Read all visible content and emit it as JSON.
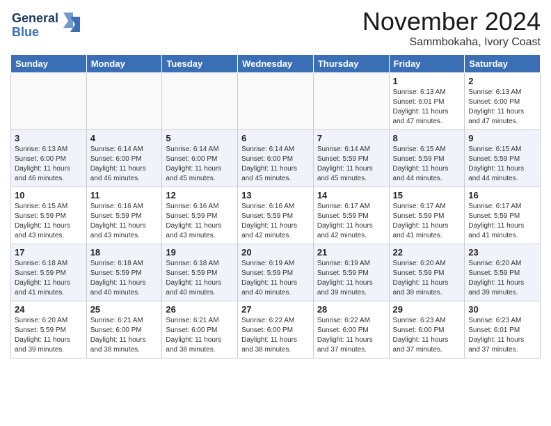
{
  "header": {
    "logo_general": "General",
    "logo_blue": "Blue",
    "month": "November 2024",
    "location": "Sammbokaha, Ivory Coast"
  },
  "weekdays": [
    "Sunday",
    "Monday",
    "Tuesday",
    "Wednesday",
    "Thursday",
    "Friday",
    "Saturday"
  ],
  "weeks": [
    [
      {
        "day": "",
        "info": ""
      },
      {
        "day": "",
        "info": ""
      },
      {
        "day": "",
        "info": ""
      },
      {
        "day": "",
        "info": ""
      },
      {
        "day": "",
        "info": ""
      },
      {
        "day": "1",
        "info": "Sunrise: 6:13 AM\nSunset: 6:01 PM\nDaylight: 11 hours and 47 minutes."
      },
      {
        "day": "2",
        "info": "Sunrise: 6:13 AM\nSunset: 6:00 PM\nDaylight: 11 hours and 47 minutes."
      }
    ],
    [
      {
        "day": "3",
        "info": "Sunrise: 6:13 AM\nSunset: 6:00 PM\nDaylight: 11 hours and 46 minutes."
      },
      {
        "day": "4",
        "info": "Sunrise: 6:14 AM\nSunset: 6:00 PM\nDaylight: 11 hours and 46 minutes."
      },
      {
        "day": "5",
        "info": "Sunrise: 6:14 AM\nSunset: 6:00 PM\nDaylight: 11 hours and 45 minutes."
      },
      {
        "day": "6",
        "info": "Sunrise: 6:14 AM\nSunset: 6:00 PM\nDaylight: 11 hours and 45 minutes."
      },
      {
        "day": "7",
        "info": "Sunrise: 6:14 AM\nSunset: 5:59 PM\nDaylight: 11 hours and 45 minutes."
      },
      {
        "day": "8",
        "info": "Sunrise: 6:15 AM\nSunset: 5:59 PM\nDaylight: 11 hours and 44 minutes."
      },
      {
        "day": "9",
        "info": "Sunrise: 6:15 AM\nSunset: 5:59 PM\nDaylight: 11 hours and 44 minutes."
      }
    ],
    [
      {
        "day": "10",
        "info": "Sunrise: 6:15 AM\nSunset: 5:59 PM\nDaylight: 11 hours and 43 minutes."
      },
      {
        "day": "11",
        "info": "Sunrise: 6:16 AM\nSunset: 5:59 PM\nDaylight: 11 hours and 43 minutes."
      },
      {
        "day": "12",
        "info": "Sunrise: 6:16 AM\nSunset: 5:59 PM\nDaylight: 11 hours and 43 minutes."
      },
      {
        "day": "13",
        "info": "Sunrise: 6:16 AM\nSunset: 5:59 PM\nDaylight: 11 hours and 42 minutes."
      },
      {
        "day": "14",
        "info": "Sunrise: 6:17 AM\nSunset: 5:59 PM\nDaylight: 11 hours and 42 minutes."
      },
      {
        "day": "15",
        "info": "Sunrise: 6:17 AM\nSunset: 5:59 PM\nDaylight: 11 hours and 41 minutes."
      },
      {
        "day": "16",
        "info": "Sunrise: 6:17 AM\nSunset: 5:59 PM\nDaylight: 11 hours and 41 minutes."
      }
    ],
    [
      {
        "day": "17",
        "info": "Sunrise: 6:18 AM\nSunset: 5:59 PM\nDaylight: 11 hours and 41 minutes."
      },
      {
        "day": "18",
        "info": "Sunrise: 6:18 AM\nSunset: 5:59 PM\nDaylight: 11 hours and 40 minutes."
      },
      {
        "day": "19",
        "info": "Sunrise: 6:18 AM\nSunset: 5:59 PM\nDaylight: 11 hours and 40 minutes."
      },
      {
        "day": "20",
        "info": "Sunrise: 6:19 AM\nSunset: 5:59 PM\nDaylight: 11 hours and 40 minutes."
      },
      {
        "day": "21",
        "info": "Sunrise: 6:19 AM\nSunset: 5:59 PM\nDaylight: 11 hours and 39 minutes."
      },
      {
        "day": "22",
        "info": "Sunrise: 6:20 AM\nSunset: 5:59 PM\nDaylight: 11 hours and 39 minutes."
      },
      {
        "day": "23",
        "info": "Sunrise: 6:20 AM\nSunset: 5:59 PM\nDaylight: 11 hours and 39 minutes."
      }
    ],
    [
      {
        "day": "24",
        "info": "Sunrise: 6:20 AM\nSunset: 5:59 PM\nDaylight: 11 hours and 39 minutes."
      },
      {
        "day": "25",
        "info": "Sunrise: 6:21 AM\nSunset: 6:00 PM\nDaylight: 11 hours and 38 minutes."
      },
      {
        "day": "26",
        "info": "Sunrise: 6:21 AM\nSunset: 6:00 PM\nDaylight: 11 hours and 38 minutes."
      },
      {
        "day": "27",
        "info": "Sunrise: 6:22 AM\nSunset: 6:00 PM\nDaylight: 11 hours and 38 minutes."
      },
      {
        "day": "28",
        "info": "Sunrise: 6:22 AM\nSunset: 6:00 PM\nDaylight: 11 hours and 37 minutes."
      },
      {
        "day": "29",
        "info": "Sunrise: 6:23 AM\nSunset: 6:00 PM\nDaylight: 11 hours and 37 minutes."
      },
      {
        "day": "30",
        "info": "Sunrise: 6:23 AM\nSunset: 6:01 PM\nDaylight: 11 hours and 37 minutes."
      }
    ]
  ]
}
